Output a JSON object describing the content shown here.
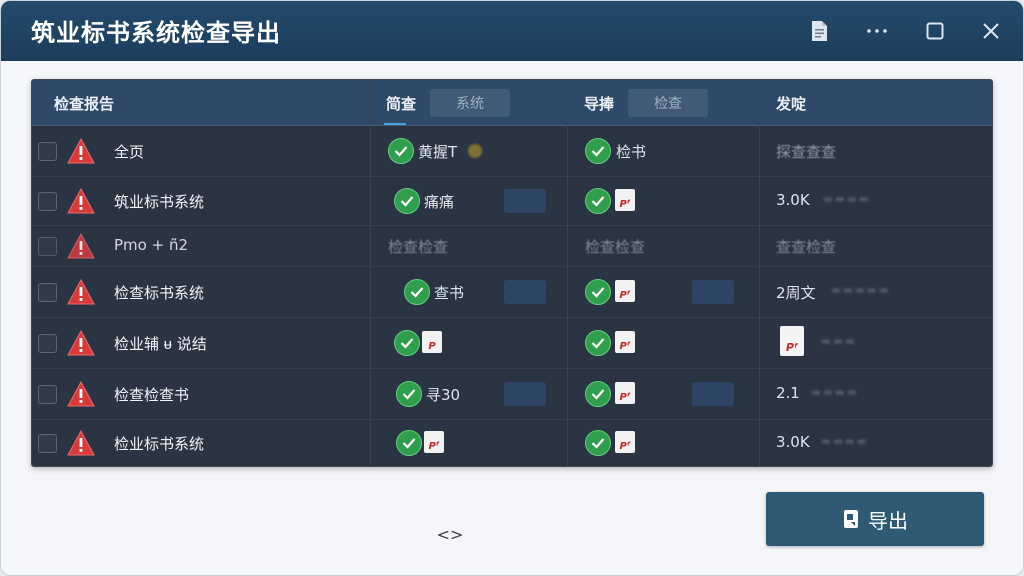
{
  "window": {
    "title": "筑业标书系统检查导出"
  },
  "table": {
    "headers": {
      "report": "检查报告",
      "col2": "简查",
      "col2_tab": "系统",
      "col3": "导捧",
      "col3_tab": "检查",
      "col4": "发啶"
    },
    "rows": [
      {
        "name": "全页",
        "col2_text": "黄握T",
        "col3_text": "检书",
        "col4_text": "探查查查"
      },
      {
        "name": "筑业标书系统",
        "col2_text": "痛痛",
        "col3_text": "",
        "col4_text": "3.0K"
      },
      {
        "name": "Pmo + ñ2",
        "col2_text": "检查检查",
        "col3_text": "检查检查",
        "col4_text": "查查检查"
      },
      {
        "name": "检查标书系统",
        "col2_text": "查书",
        "col3_text": "",
        "col4_text": "2周文"
      },
      {
        "name": "检业辅 ᵾ 说结",
        "col2_text": "",
        "col3_text": "",
        "col4_text": ""
      },
      {
        "name": "检查检查书",
        "col2_text": "寻30",
        "col3_text": "",
        "col4_text": "2.1"
      },
      {
        "name": "检业标书系统",
        "col2_text": "",
        "col3_text": "",
        "col4_text": "3.0K"
      }
    ]
  },
  "actions": {
    "export_label": "导出",
    "pager_symbol": "<>"
  },
  "colors": {
    "titlebar": "#244a6c",
    "table_bg": "#2a3442",
    "header_bg": "#2f4a68",
    "check_green": "#2f9e4d",
    "warning_red": "#d83a3a",
    "export_button": "#2f5a74"
  }
}
